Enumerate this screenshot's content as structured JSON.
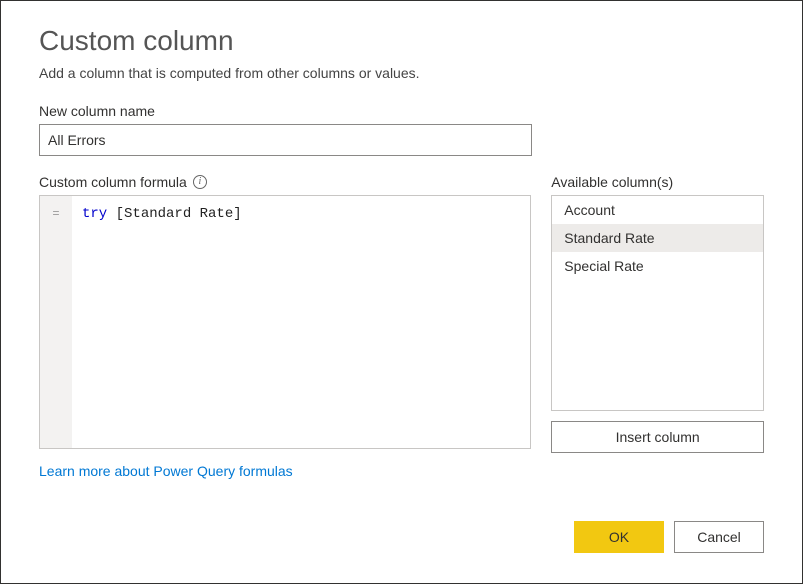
{
  "dialog": {
    "title": "Custom column",
    "subtitle": "Add a column that is computed from other columns or values."
  },
  "name": {
    "label": "New column name",
    "value": "All Errors"
  },
  "formula": {
    "label": "Custom column formula",
    "gutter": "=",
    "keyword": "try",
    "rest": " [Standard Rate]"
  },
  "available": {
    "label": "Available column(s)",
    "items": [
      "Account",
      "Standard Rate",
      "Special Rate"
    ],
    "selected_index": 1,
    "insert_label": "Insert column"
  },
  "link": {
    "text": "Learn more about Power Query formulas"
  },
  "footer": {
    "ok": "OK",
    "cancel": "Cancel"
  }
}
